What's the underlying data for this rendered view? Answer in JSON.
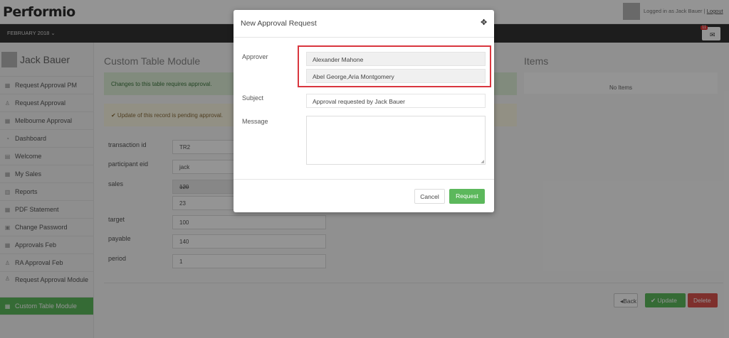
{
  "header": {
    "logo": "Performio",
    "logged_in_text": "Logged in as Jack Bauer | ",
    "logout_label": "Logout",
    "period_label": "FEBRUARY 2018 ⌄",
    "notification_count": "11"
  },
  "sidebar": {
    "user_name": "Jack Bauer",
    "items": [
      {
        "label": "Request Approval PM",
        "icon": "grid-icon"
      },
      {
        "label": "Request Approval",
        "icon": "thumbs-up-icon"
      },
      {
        "label": "Melbourne Approval",
        "icon": "grid-icon"
      },
      {
        "label": "Dashboard",
        "icon": "dashboard-icon"
      },
      {
        "label": "Welcome",
        "icon": "document-icon"
      },
      {
        "label": "My Sales",
        "icon": "grid-icon"
      },
      {
        "label": "Reports",
        "icon": "bar-chart-icon"
      },
      {
        "label": "PDF Statement",
        "icon": "grid-icon"
      },
      {
        "label": "Change Password",
        "icon": "lock-icon"
      },
      {
        "label": "Approvals Feb",
        "icon": "grid-icon"
      },
      {
        "label": "RA Approval Feb",
        "icon": "thumbs-up-icon"
      },
      {
        "label": "Request Approval Module",
        "icon": "thumbs-up-icon"
      },
      {
        "label": "Custom Table Module",
        "icon": "grid-icon",
        "active": true
      }
    ]
  },
  "main": {
    "title": "Custom Table Module",
    "alert_approval": "Changes to this table requires approval.",
    "alert_pending": "✔ Update of this record is pending approval.",
    "items_title": "Items",
    "items_empty": "No Items",
    "fields": {
      "transaction_id": {
        "label": "transaction id",
        "value": "TR2"
      },
      "participant_eid": {
        "label": "participant eid",
        "value": "jack"
      },
      "sales": {
        "label": "sales",
        "old_value": "120",
        "new_value": "23"
      },
      "target": {
        "label": "target",
        "value": "100"
      },
      "payable": {
        "label": "payable",
        "value": "140"
      },
      "period": {
        "label": "period",
        "value": "1"
      }
    },
    "back_label": "◂Back",
    "update_label": "✔ Update",
    "delete_label": "Delete"
  },
  "modal": {
    "title": "New Approval Request",
    "approver_label": "Approver",
    "approvers": [
      "Alexander Mahone",
      "Abel George,Aria Montgomery"
    ],
    "subject_label": "Subject",
    "subject_value": "Approval requested by Jack Bauer",
    "message_label": "Message",
    "message_value": "",
    "cancel_label": "Cancel",
    "request_label": "Request"
  },
  "colors": {
    "success": "#5cb85c",
    "danger": "#d9534f",
    "highlight": "#d9363e",
    "navbar": "#333333"
  }
}
